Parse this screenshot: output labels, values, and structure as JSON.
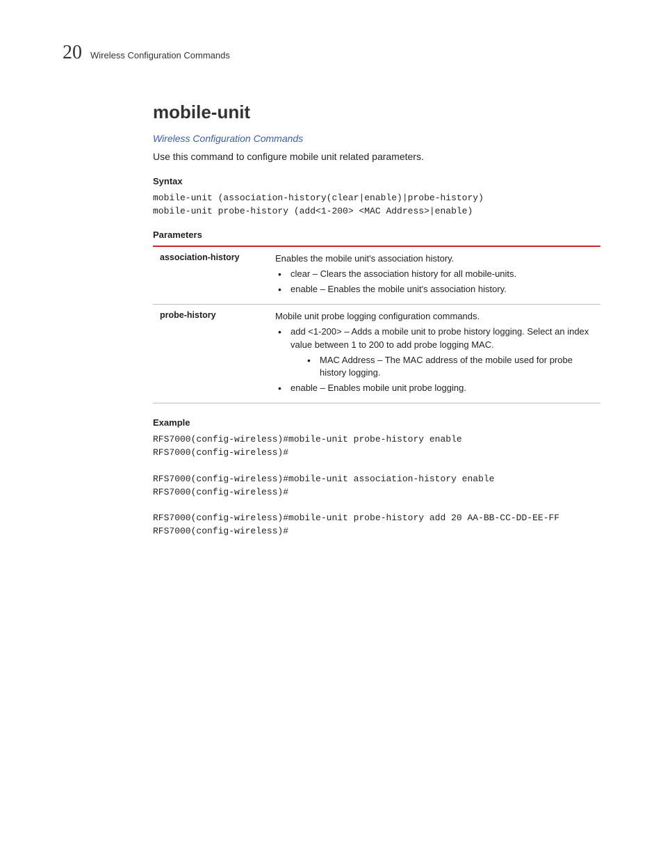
{
  "header": {
    "page_number": "20",
    "running_head": "Wireless Configuration Commands"
  },
  "title": "mobile-unit",
  "breadcrumb_link": "Wireless Configuration Commands",
  "intro": "Use this command to configure mobile unit related parameters.",
  "syntax": {
    "heading": "Syntax",
    "code": "mobile-unit (association-history(clear|enable)|probe-history)\nmobile-unit probe-history (add<1-200> <MAC Address>|enable)"
  },
  "parameters": {
    "heading": "Parameters",
    "rows": [
      {
        "name": "association-history",
        "lead": "Enables the mobile unit's association history.",
        "bullets": [
          "clear – Clears the association history for all mobile-units.",
          "enable – Enables the mobile unit's association history."
        ]
      },
      {
        "name": "probe-history",
        "lead": "Mobile unit probe logging configuration commands.",
        "bullets_first": "add <1-200> – Adds a mobile unit to probe history logging. Select an index value between 1 to 200 to add probe logging MAC.",
        "nested": "MAC Address – The MAC address of the mobile used for probe history logging.",
        "bullets_last": "enable – Enables mobile unit probe logging."
      }
    ]
  },
  "example": {
    "heading": "Example",
    "code": "RFS7000(config-wireless)#mobile-unit probe-history enable\nRFS7000(config-wireless)#\n\nRFS7000(config-wireless)#mobile-unit association-history enable\nRFS7000(config-wireless)#\n\nRFS7000(config-wireless)#mobile-unit probe-history add 20 AA-BB-CC-DD-EE-FF\nRFS7000(config-wireless)#"
  }
}
